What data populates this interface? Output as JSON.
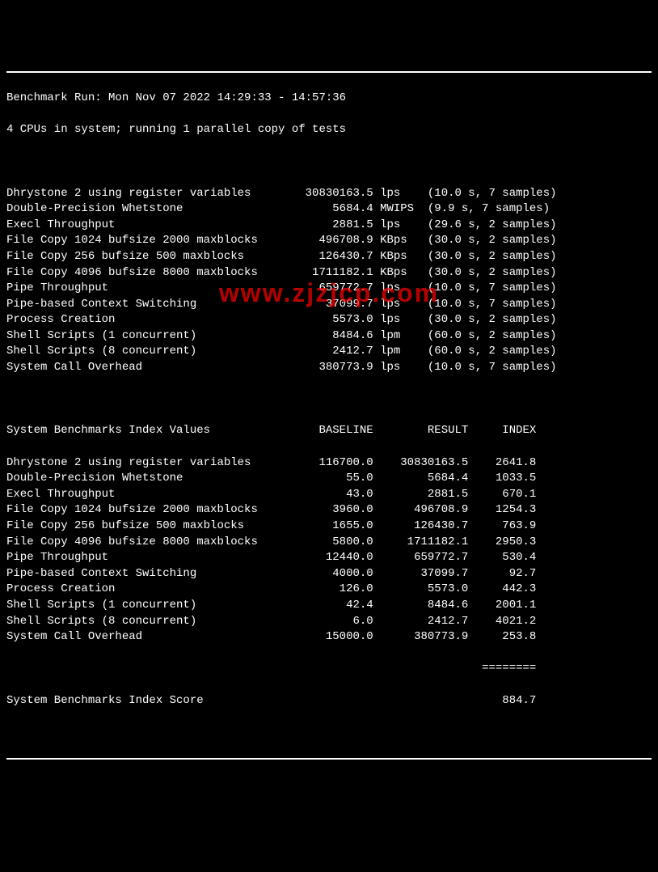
{
  "header": {
    "run_line": "Benchmark Run: Mon Nov 07 2022 14:29:33 - 14:57:36",
    "cpu_line": "4 CPUs in system; running 1 parallel copy of tests"
  },
  "watermark": "www.zjzjcp.com",
  "results": [
    {
      "name": "Dhrystone 2 using register variables",
      "value": "30830163.5",
      "unit": "lps",
      "timing": "(10.0 s, 7 samples)"
    },
    {
      "name": "Double-Precision Whetstone",
      "value": "5684.4",
      "unit": "MWIPS",
      "timing": "(9.9 s, 7 samples)"
    },
    {
      "name": "Execl Throughput",
      "value": "2881.5",
      "unit": "lps",
      "timing": "(29.6 s, 2 samples)"
    },
    {
      "name": "File Copy 1024 bufsize 2000 maxblocks",
      "value": "496708.9",
      "unit": "KBps",
      "timing": "(30.0 s, 2 samples)"
    },
    {
      "name": "File Copy 256 bufsize 500 maxblocks",
      "value": "126430.7",
      "unit": "KBps",
      "timing": "(30.0 s, 2 samples)"
    },
    {
      "name": "File Copy 4096 bufsize 8000 maxblocks",
      "value": "1711182.1",
      "unit": "KBps",
      "timing": "(30.0 s, 2 samples)"
    },
    {
      "name": "Pipe Throughput",
      "value": "659772.7",
      "unit": "lps",
      "timing": "(10.0 s, 7 samples)"
    },
    {
      "name": "Pipe-based Context Switching",
      "value": "37099.7",
      "unit": "lps",
      "timing": "(10.0 s, 7 samples)"
    },
    {
      "name": "Process Creation",
      "value": "5573.0",
      "unit": "lps",
      "timing": "(30.0 s, 2 samples)"
    },
    {
      "name": "Shell Scripts (1 concurrent)",
      "value": "8484.6",
      "unit": "lpm",
      "timing": "(60.0 s, 2 samples)"
    },
    {
      "name": "Shell Scripts (8 concurrent)",
      "value": "2412.7",
      "unit": "lpm",
      "timing": "(60.0 s, 2 samples)"
    },
    {
      "name": "System Call Overhead",
      "value": "380773.9",
      "unit": "lps",
      "timing": "(10.0 s, 7 samples)"
    }
  ],
  "index_header": {
    "title": "System Benchmarks Index Values",
    "col1": "BASELINE",
    "col2": "RESULT",
    "col3": "INDEX"
  },
  "index_rows": [
    {
      "name": "Dhrystone 2 using register variables",
      "baseline": "116700.0",
      "result": "30830163.5",
      "index": "2641.8"
    },
    {
      "name": "Double-Precision Whetstone",
      "baseline": "55.0",
      "result": "5684.4",
      "index": "1033.5"
    },
    {
      "name": "Execl Throughput",
      "baseline": "43.0",
      "result": "2881.5",
      "index": "670.1"
    },
    {
      "name": "File Copy 1024 bufsize 2000 maxblocks",
      "baseline": "3960.0",
      "result": "496708.9",
      "index": "1254.3"
    },
    {
      "name": "File Copy 256 bufsize 500 maxblocks",
      "baseline": "1655.0",
      "result": "126430.7",
      "index": "763.9"
    },
    {
      "name": "File Copy 4096 bufsize 8000 maxblocks",
      "baseline": "5800.0",
      "result": "1711182.1",
      "index": "2950.3"
    },
    {
      "name": "Pipe Throughput",
      "baseline": "12440.0",
      "result": "659772.7",
      "index": "530.4"
    },
    {
      "name": "Pipe-based Context Switching",
      "baseline": "4000.0",
      "result": "37099.7",
      "index": "92.7"
    },
    {
      "name": "Process Creation",
      "baseline": "126.0",
      "result": "5573.0",
      "index": "442.3"
    },
    {
      "name": "Shell Scripts (1 concurrent)",
      "baseline": "42.4",
      "result": "8484.6",
      "index": "2001.1"
    },
    {
      "name": "Shell Scripts (8 concurrent)",
      "baseline": "6.0",
      "result": "2412.7",
      "index": "4021.2"
    },
    {
      "name": "System Call Overhead",
      "baseline": "15000.0",
      "result": "380773.9",
      "index": "253.8"
    }
  ],
  "score": {
    "label": "System Benchmarks Index Score",
    "value": "884.7"
  },
  "divider": "========"
}
